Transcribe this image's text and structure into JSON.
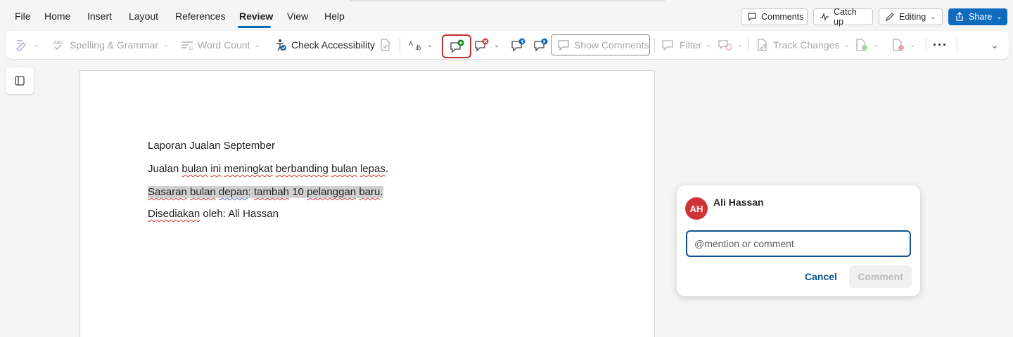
{
  "menu": {
    "items": [
      "File",
      "Home",
      "Insert",
      "Layout",
      "References",
      "Review",
      "View",
      "Help"
    ],
    "active": "Review"
  },
  "topbar": {
    "comments_label": "Comments",
    "catchup_label": "Catch up",
    "editing_label": "Editing",
    "share_label": "Share"
  },
  "ribbon": {
    "spelling_label": "Spelling & Grammar",
    "wordcount_label": "Word Count",
    "accessibility_label": "Check Accessibility",
    "show_comments_label": "Show Comments",
    "filter_label": "Filter",
    "track_changes_label": "Track Changes",
    "more_label": "···"
  },
  "document": {
    "line1": "Laporan Jualan September",
    "line2": {
      "p1": "Jualan ",
      "w1": "bulan",
      "p2": " ",
      "w2": "ini",
      "p3": " ",
      "w3": "meningkat",
      "p4": " ",
      "w4": "berbanding",
      "p5": " ",
      "w5": "bulan",
      "p6": " ",
      "w6": "lepas",
      "p7": "."
    },
    "line3": {
      "w1": "Sasaran",
      "p1": " ",
      "w2": "bulan",
      "p2": " ",
      "w3": "depan",
      "p3": ": ",
      "w4": "tambah",
      "p4": " 10 ",
      "w5": "pelanggan",
      "p5": " ",
      "w6": "baru",
      "p6": "."
    },
    "line4": {
      "w1": "Disediakan",
      "p1": " oleh: Ali Hassan"
    }
  },
  "comment_card": {
    "avatar_initials": "AH",
    "author": "Ali Hassan",
    "placeholder": "@mention or comment",
    "value": "",
    "cancel_label": "Cancel",
    "submit_label": "Comment",
    "avatar_color": "#d13438"
  },
  "colors": {
    "accent": "#0f6cbd",
    "highlight_box": "#c4302b",
    "spelling_squiggle": "#d13438"
  }
}
